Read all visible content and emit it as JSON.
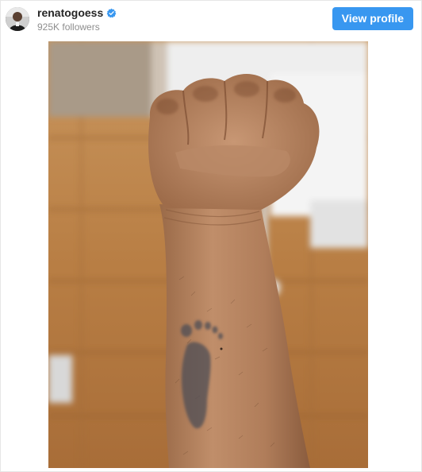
{
  "header": {
    "username": "renatogoess",
    "followers_text": "925K followers",
    "view_profile_label": "View profile",
    "avatar_icon": "profile-avatar",
    "verified_icon": "verified-badge-icon",
    "accent_color": "#3897f0"
  },
  "post": {
    "image_icon": "post-photo"
  }
}
